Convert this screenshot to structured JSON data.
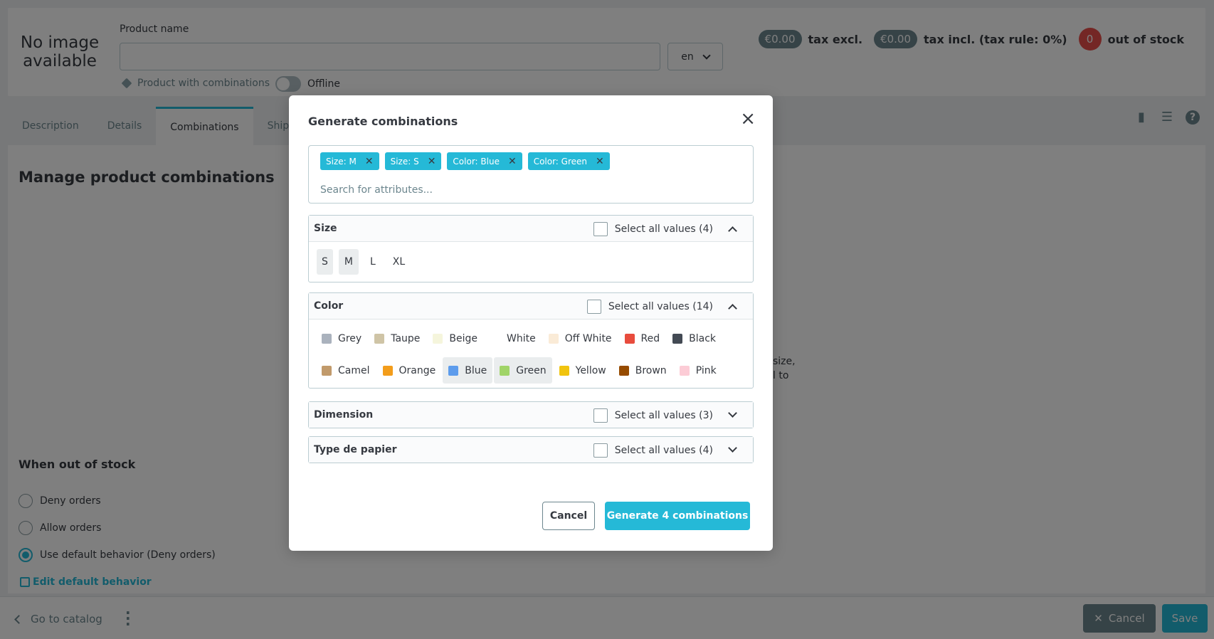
{
  "header": {
    "no_image": "No image available",
    "product_name_label": "Product name",
    "product_name_value": "",
    "language": "en",
    "product_type": "Product with combinations",
    "status_label": "Offline",
    "price_tax_excl": "€0.00",
    "tax_excl_label": "tax excl.",
    "price_tax_incl": "€0.00",
    "tax_incl_label": "tax incl. (tax rule: 0%)",
    "stock_count": "0",
    "stock_label": "out of stock"
  },
  "tabs": [
    {
      "label": "Description"
    },
    {
      "label": "Details"
    },
    {
      "label": "Combinations",
      "active": true
    },
    {
      "label": "Shippin"
    }
  ],
  "main": {
    "title": "Manage product combinations",
    "side_text_line1": "size,",
    "side_text_line2": "l to",
    "out_of_stock_title": "When out of stock",
    "options": [
      {
        "label": "Deny orders",
        "selected": false
      },
      {
        "label": "Allow orders",
        "selected": false
      },
      {
        "label": "Use default behavior (Deny orders)",
        "selected": true
      }
    ],
    "edit_default": "Edit default behavior"
  },
  "footer": {
    "go_to_catalog": "Go to catalog",
    "cancel": "Cancel",
    "save": "Save"
  },
  "modal": {
    "title": "Generate combinations",
    "search_placeholder": "Search for attributes...",
    "tags": [
      "Size: M",
      "Size: S",
      "Color: Blue",
      "Color: Green"
    ],
    "groups": {
      "size": {
        "name": "Size",
        "select_all": "Select all values (4)",
        "values": [
          {
            "label": "S",
            "selected": true
          },
          {
            "label": "M",
            "selected": true
          },
          {
            "label": "L",
            "selected": false
          },
          {
            "label": "XL",
            "selected": false
          }
        ]
      },
      "color": {
        "name": "Color",
        "select_all": "Select all values (14)",
        "values": [
          {
            "label": "Grey",
            "color": "#aab2bd",
            "selected": false
          },
          {
            "label": "Taupe",
            "color": "#cfc4a6",
            "selected": false
          },
          {
            "label": "Beige",
            "color": "#f5f5dc",
            "selected": false
          },
          {
            "label": "White",
            "color": "#ffffff",
            "selected": false
          },
          {
            "label": "Off White",
            "color": "#faebd7",
            "selected": false
          },
          {
            "label": "Red",
            "color": "#e84c3d",
            "selected": false
          },
          {
            "label": "Black",
            "color": "#434a54",
            "selected": false
          },
          {
            "label": "Camel",
            "color": "#c19a6b",
            "selected": false
          },
          {
            "label": "Orange",
            "color": "#f39d1b",
            "selected": false
          },
          {
            "label": "Blue",
            "color": "#5d9cec",
            "selected": true
          },
          {
            "label": "Green",
            "color": "#a0d468",
            "selected": true
          },
          {
            "label": "Yellow",
            "color": "#f1c40f",
            "selected": false
          },
          {
            "label": "Brown",
            "color": "#964b00",
            "selected": false
          },
          {
            "label": "Pink",
            "color": "#fcccd6",
            "selected": false
          }
        ]
      },
      "dimension": {
        "name": "Dimension",
        "select_all": "Select all values (3)"
      },
      "paper": {
        "name": "Type de papier",
        "select_all": "Select all values (4)"
      }
    },
    "cancel": "Cancel",
    "generate": "Generate 4 combinations"
  },
  "colors": {
    "accent": "#25b9d7",
    "danger": "#e84e4a",
    "muted": "#6c868e"
  }
}
